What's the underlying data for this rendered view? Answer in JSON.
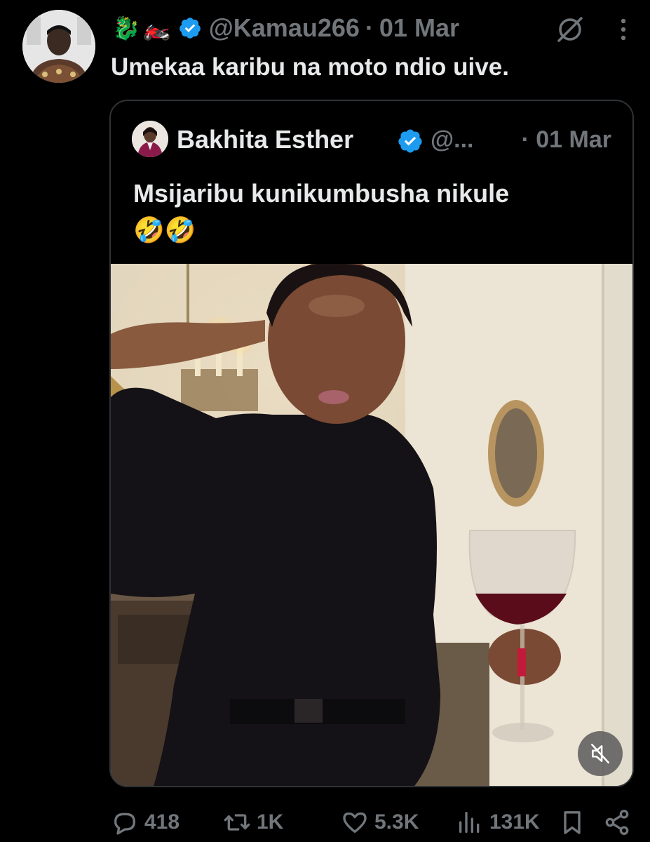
{
  "tweet": {
    "emojis": [
      "🐉",
      "🏍️"
    ],
    "handle": "@Kamau266",
    "separator": "·",
    "date": "01 Mar",
    "text": "Umekaa karibu na moto ndio uive."
  },
  "quote": {
    "name": "Bakhita Esther",
    "handle": "@...",
    "date": "· 01 Mar",
    "text": "Msijaribu kunikumbusha nikule",
    "emojis": "🤣🤣"
  },
  "actions": {
    "replies": "418",
    "reposts": "1K",
    "likes": "5.3K",
    "views": "131K"
  },
  "icons": {
    "verified": "verified-badge-icon",
    "grok": "grok-icon",
    "more": "more-options-icon",
    "mute": "mute-icon",
    "reply": "reply-icon",
    "repost": "repost-icon",
    "like": "like-icon",
    "views": "views-icon",
    "bookmark": "bookmark-icon",
    "share": "share-icon"
  },
  "colors": {
    "background": "#000000",
    "text_primary": "#e7e9ea",
    "text_secondary": "#71767b",
    "verified_blue": "#1d9bf0",
    "border": "#2f3336"
  }
}
